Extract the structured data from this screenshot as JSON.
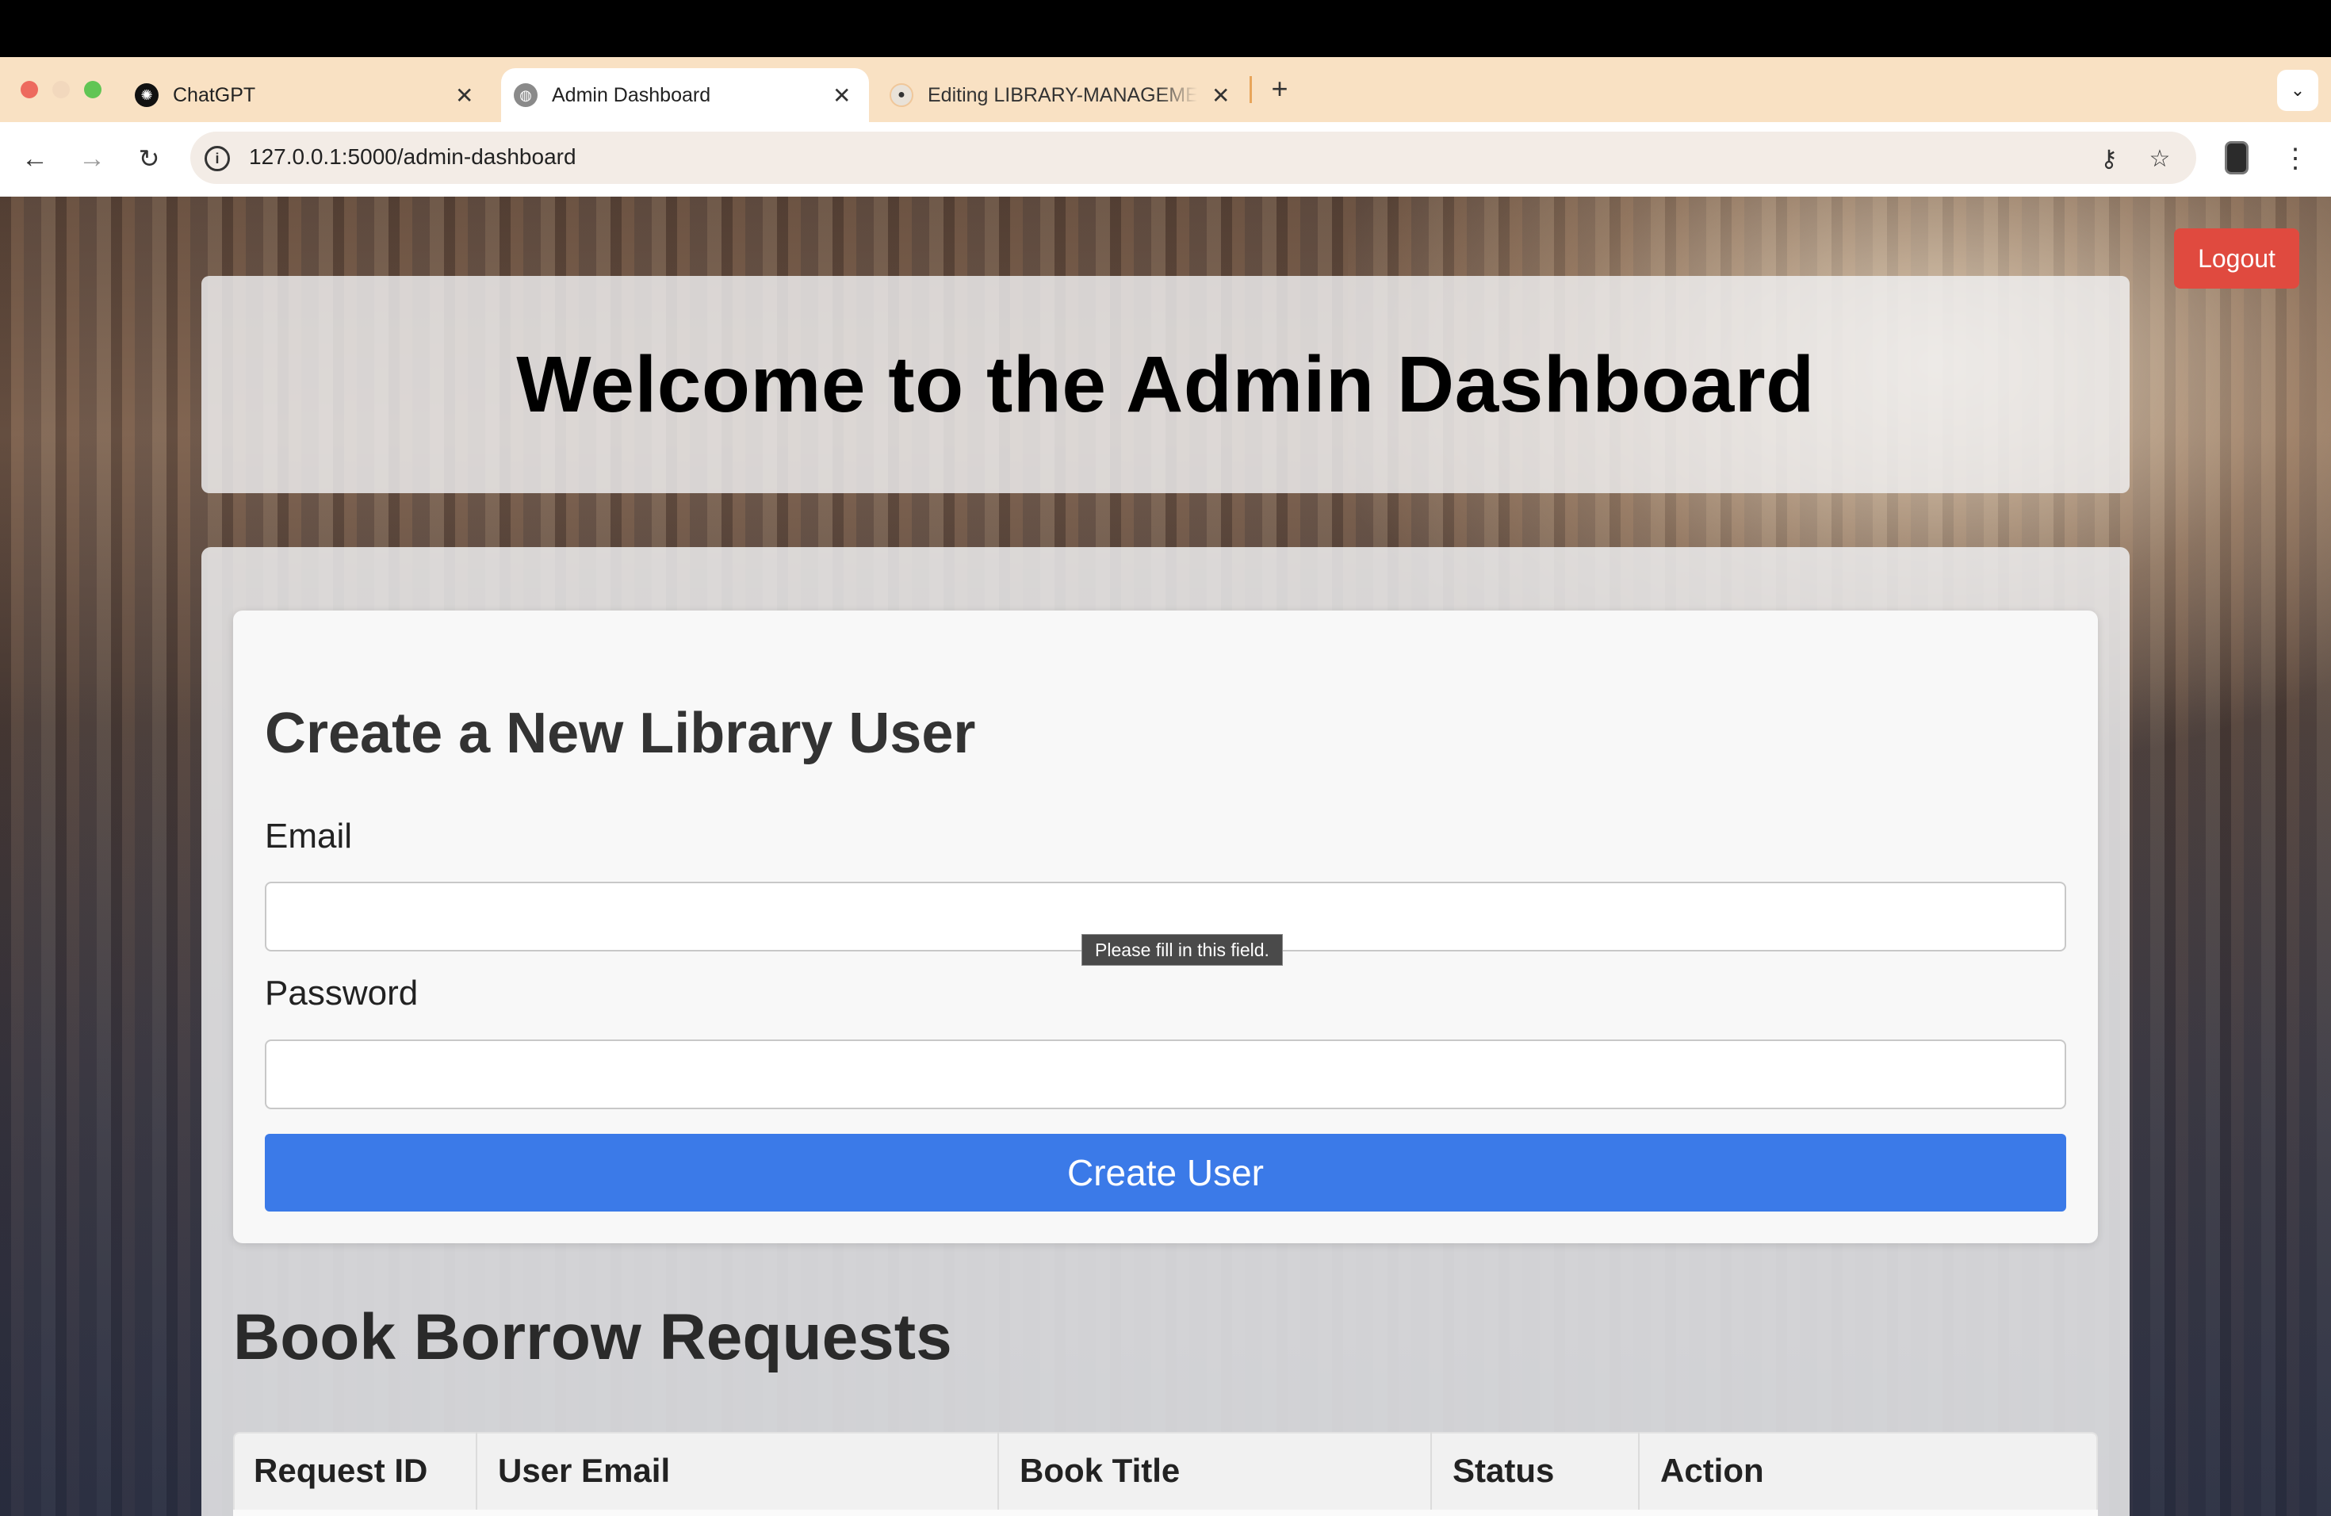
{
  "browser": {
    "tabs": [
      {
        "title": "ChatGPT",
        "icon": "chatgpt-icon"
      },
      {
        "title": "Admin Dashboard",
        "icon": "globe-icon",
        "active": true
      },
      {
        "title": "Editing LIBRARY-MANAGEMENT",
        "icon": "github-icon"
      }
    ],
    "url": "127.0.0.1:5000/admin-dashboard"
  },
  "page": {
    "logout_label": "Logout",
    "heading": "Welcome to the Admin Dashboard",
    "create_user_form": {
      "title": "Create a New Library User",
      "email_label": "Email",
      "email_value": "",
      "password_label": "Password",
      "password_value": "",
      "validation_tooltip": "Please fill in this field.",
      "submit_label": "Create User"
    },
    "borrow_requests": {
      "title": "Book Borrow Requests",
      "columns": [
        "Request ID",
        "User Email",
        "Book Title",
        "Status",
        "Action"
      ]
    }
  },
  "colors": {
    "tab_strip": "#f9e1c3",
    "logout_button": "#e04a3f",
    "primary_button": "#3b7ae8"
  }
}
